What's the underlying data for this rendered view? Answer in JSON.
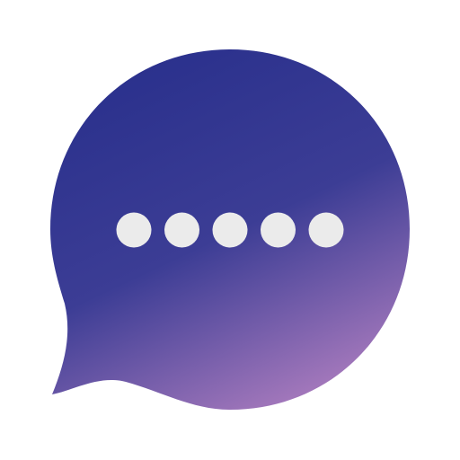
{
  "icon": {
    "name": "chat-bubble-icon",
    "dot_count": 5,
    "colors": {
      "background": "#ffffff",
      "bubble_gradient_top": "#2B318D",
      "bubble_gradient_mid": "#3C3D95",
      "bubble_gradient_bottom": "#B07FC0",
      "dots": "#EBEBEB"
    }
  }
}
